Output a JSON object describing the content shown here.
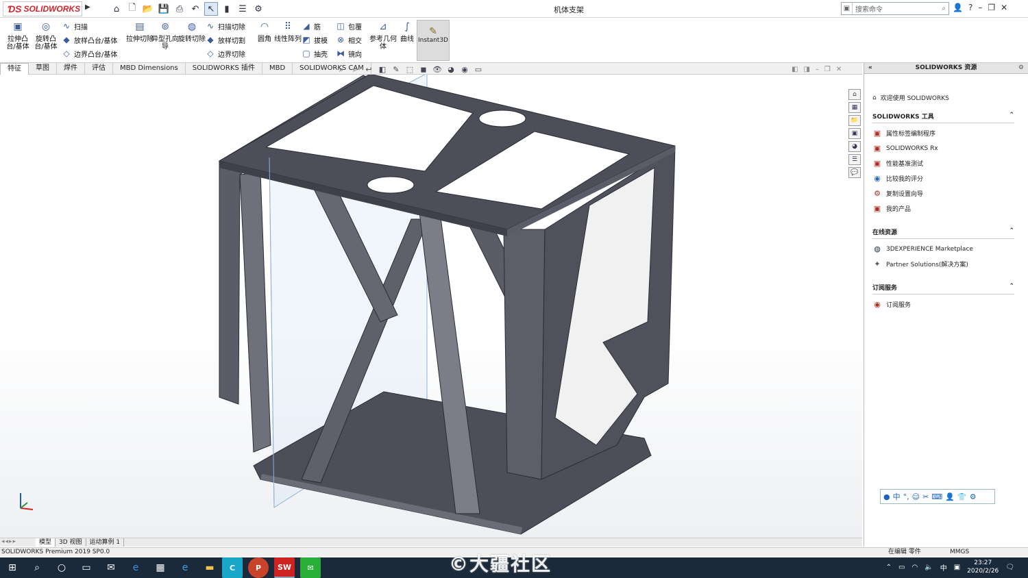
{
  "app": {
    "logo": "SOLIDWORKS",
    "title": "机体支架"
  },
  "search": {
    "placeholder": "搜索命令"
  },
  "ribbon": {
    "big": [
      {
        "label": "拉伸凸台/基体"
      },
      {
        "label": "旋转凸台/基体"
      },
      {
        "label": "拉伸切除"
      },
      {
        "label": "异型孔向导"
      },
      {
        "label": "旋转切除"
      },
      {
        "label": "圆角"
      },
      {
        "label": "线性阵列"
      },
      {
        "label": "参考几何体"
      },
      {
        "label": "曲线"
      }
    ],
    "small": {
      "sweep": "扫描",
      "loft": "放样凸台/基体",
      "boundary": "边界凸台/基体",
      "sweep_cut": "扫描切除",
      "loft_cut": "放样切割",
      "boundary_cut": "边界切除",
      "rib": "筋",
      "draft": "拔模",
      "shell": "抽壳",
      "wrap": "包覆",
      "intersect": "相交",
      "mirror": "镜向"
    },
    "instant3d": "Instant3D"
  },
  "tabs": [
    "特征",
    "草图",
    "焊件",
    "评估",
    "MBD Dimensions",
    "SOLIDWORKS 插件",
    "MBD",
    "SOLIDWORKS CAM"
  ],
  "bottom_tabs": [
    "模型",
    "3D 视图",
    "运动算例 1"
  ],
  "status": {
    "left": "SOLIDWORKS Premium 2019 SP0.0",
    "editing": "在编辑 零件",
    "units": "MMGS"
  },
  "taskpane": {
    "title": "SOLIDWORKS 资源",
    "welcome": "欢迎使用 SOLIDWORKS",
    "sections": [
      {
        "title": "SOLIDWORKS 工具",
        "items": [
          "属性标签编制程序",
          "SOLIDWORKS Rx",
          "性能基准测试",
          "比较我的评分",
          "复制设置向导",
          "我的产品"
        ]
      },
      {
        "title": "在线资源",
        "items": [
          "3DEXPERIENCE Marketplace",
          "Partner Solutions(解决方案)"
        ]
      },
      {
        "title": "订阅服务",
        "items": [
          "订阅服务"
        ]
      }
    ]
  },
  "taskbar": {
    "time": "23:27",
    "date": "2020/2/26",
    "ime_lang": "中"
  },
  "watermark": "©大疆社区",
  "colors": {
    "model_dark": "#4c4e5a",
    "model_light": "#8c8e9a",
    "taskbar": "#1b2a3a",
    "logo_red": "#d2232a"
  }
}
